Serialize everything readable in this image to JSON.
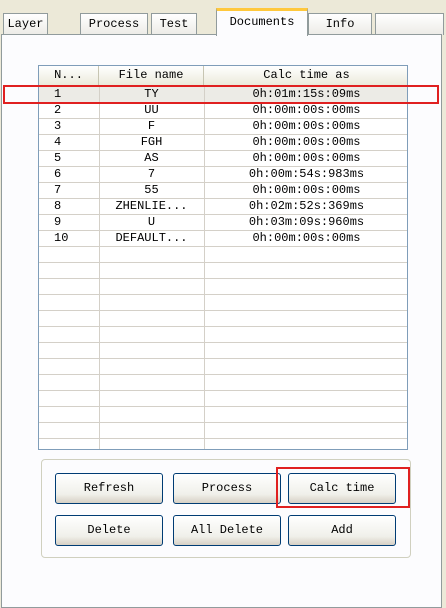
{
  "tabs": [
    {
      "label": "Layer"
    },
    {
      "label": "Process"
    },
    {
      "label": "Test"
    },
    {
      "label": "Documents"
    },
    {
      "label": "Info"
    },
    {
      "label": ""
    }
  ],
  "list": {
    "columns": {
      "num": "N...",
      "file": "File name",
      "calc": "Calc time as"
    },
    "rows": [
      {
        "num": "1",
        "file": "TY",
        "calc": "0h:01m:15s:09ms"
      },
      {
        "num": "2",
        "file": "UU",
        "calc": "0h:00m:00s:00ms"
      },
      {
        "num": "3",
        "file": "F",
        "calc": "0h:00m:00s:00ms"
      },
      {
        "num": "4",
        "file": "FGH",
        "calc": "0h:00m:00s:00ms"
      },
      {
        "num": "5",
        "file": "AS",
        "calc": "0h:00m:00s:00ms"
      },
      {
        "num": "6",
        "file": "7",
        "calc": "0h:00m:54s:983ms"
      },
      {
        "num": "7",
        "file": "55",
        "calc": "0h:00m:00s:00ms"
      },
      {
        "num": "8",
        "file": "ZHENLIE...",
        "calc": "0h:02m:52s:369ms"
      },
      {
        "num": "9",
        "file": "U",
        "calc": "0h:03m:09s:960ms"
      },
      {
        "num": "10",
        "file": "DEFAULT...",
        "calc": "0h:00m:00s:00ms"
      }
    ]
  },
  "buttons": {
    "refresh": "Refresh",
    "process": "Process",
    "calc_time": "Calc time",
    "delete": "Delete",
    "all_delete": "All Delete",
    "add": "Add"
  },
  "colors": {
    "highlight": "#e02020",
    "active_tab_accent": "#ffc83c",
    "window_background": "#ece9d8"
  }
}
